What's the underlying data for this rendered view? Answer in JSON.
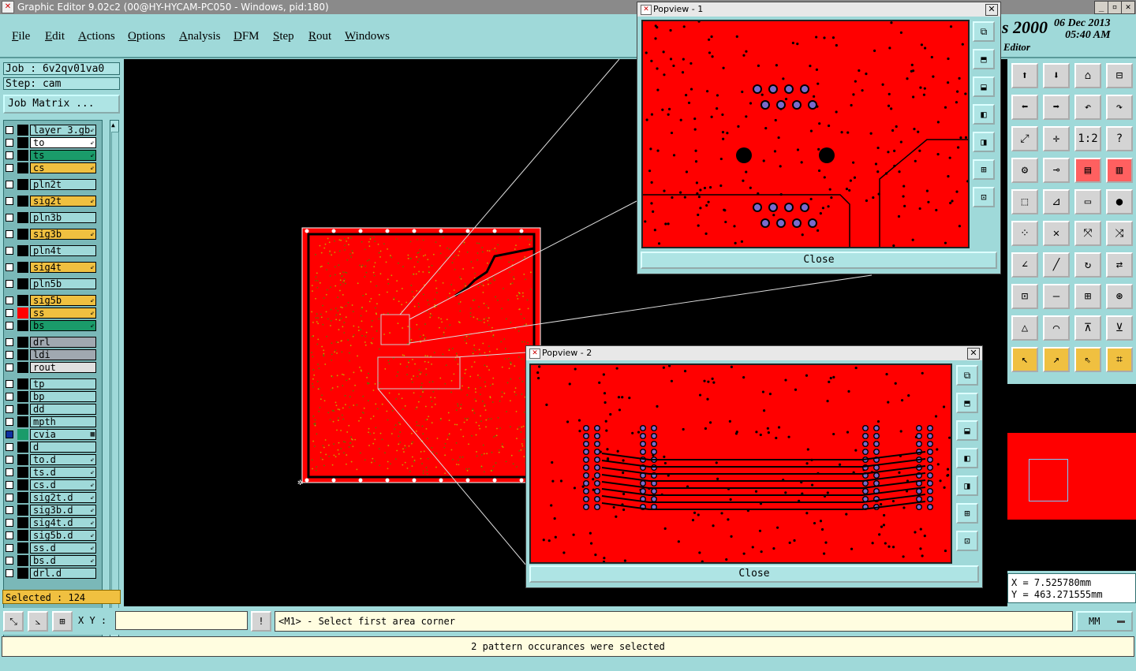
{
  "window": {
    "title": "Graphic Editor 9.02c2 (00@HY-HYCAM-PC050 - Windows, pid:180)",
    "min_label": "_",
    "max_label": "▫",
    "close_label": "✕"
  },
  "menu": [
    "File",
    "Edit",
    "Actions",
    "Options",
    "Analysis",
    "DFM",
    "Step",
    "Rout",
    "Windows"
  ],
  "brand": {
    "product_fragment": "s 2000",
    "date": "06 Dec 2013",
    "time": "05:40 AM",
    "subtitle": "Editor"
  },
  "job": {
    "job_label": "Job : 6v2qv01va0",
    "step_label": "Step: cam",
    "matrix_button": "Job Matrix ..."
  },
  "layers": [
    {
      "name": "layer_3.gb",
      "color": "#9fd9d9",
      "flag": "⇙"
    },
    {
      "name": "to",
      "color": "#ffffff",
      "flag": "⇙"
    },
    {
      "name": "ts",
      "color": "#1a9b6a",
      "flag": "⇙"
    },
    {
      "name": "cs",
      "color": "#f0c040",
      "flag": "⇙"
    },
    {
      "name": "pln2t",
      "color": "#9fd9d9",
      "flag": ""
    },
    {
      "name": "sig2t",
      "color": "#f0c040",
      "flag": "⇙"
    },
    {
      "name": "pln3b",
      "color": "#9fd9d9",
      "flag": ""
    },
    {
      "name": "sig3b",
      "color": "#f0c040",
      "flag": "⇙"
    },
    {
      "name": "pln4t",
      "color": "#9fd9d9",
      "flag": ""
    },
    {
      "name": "sig4t",
      "color": "#f0c040",
      "flag": "⇙"
    },
    {
      "name": "pln5b",
      "color": "#9fd9d9",
      "flag": ""
    },
    {
      "name": "sig5b",
      "color": "#f0c040",
      "flag": "⇙"
    },
    {
      "name": "ss",
      "color": "#f0c040",
      "flag": "⇙"
    },
    {
      "name": "bs",
      "color": "#1a9b6a",
      "flag": "⇙"
    },
    {
      "name": "drl",
      "color": "#a0a8b0",
      "flag": ""
    },
    {
      "name": "ldi",
      "color": "#a0a8b0",
      "flag": ""
    },
    {
      "name": "rout",
      "color": "#e0e0e0",
      "flag": ""
    },
    {
      "name": "tp",
      "color": "#9fd9d9",
      "flag": ""
    },
    {
      "name": "bp",
      "color": "#9fd9d9",
      "flag": ""
    },
    {
      "name": "dd",
      "color": "#9fd9d9",
      "flag": ""
    },
    {
      "name": "mpth",
      "color": "#9fd9d9",
      "flag": ""
    },
    {
      "name": "cvia",
      "color": "#9fd9d9",
      "flag": "▦"
    },
    {
      "name": "d",
      "color": "#9fd9d9",
      "flag": ""
    },
    {
      "name": "to.d",
      "color": "#9fd9d9",
      "flag": "⇙"
    },
    {
      "name": "ts.d",
      "color": "#9fd9d9",
      "flag": "⇙"
    },
    {
      "name": "cs.d",
      "color": "#9fd9d9",
      "flag": "⇙"
    },
    {
      "name": "sig2t.d",
      "color": "#9fd9d9",
      "flag": "⇙"
    },
    {
      "name": "sig3b.d",
      "color": "#9fd9d9",
      "flag": "⇙"
    },
    {
      "name": "sig4t.d",
      "color": "#9fd9d9",
      "flag": "⇙"
    },
    {
      "name": "sig5b.d",
      "color": "#9fd9d9",
      "flag": "⇙"
    },
    {
      "name": "ss.d",
      "color": "#9fd9d9",
      "flag": "⇙"
    },
    {
      "name": "bs.d",
      "color": "#9fd9d9",
      "flag": "⇙"
    },
    {
      "name": "drl.d",
      "color": "#9fd9d9",
      "flag": ""
    }
  ],
  "selected_label": "Selected : 124",
  "popview1": {
    "title": "Popview - 1",
    "close_label": "Close"
  },
  "popview2": {
    "title": "Popview - 2",
    "close_label": "Close"
  },
  "coords": {
    "x_label": "X = 7.525780mm",
    "y_label": "Y = 463.271555mm"
  },
  "cmd": {
    "xy_label": "X Y :",
    "xy_value": "",
    "prompt": "<M1> - Select first area corner",
    "units": "MM"
  },
  "status": "2 pattern occurances were selected",
  "colors": {
    "board": "#ff0000",
    "panel": "#9fd9d9",
    "highlight": "#f0c040"
  }
}
